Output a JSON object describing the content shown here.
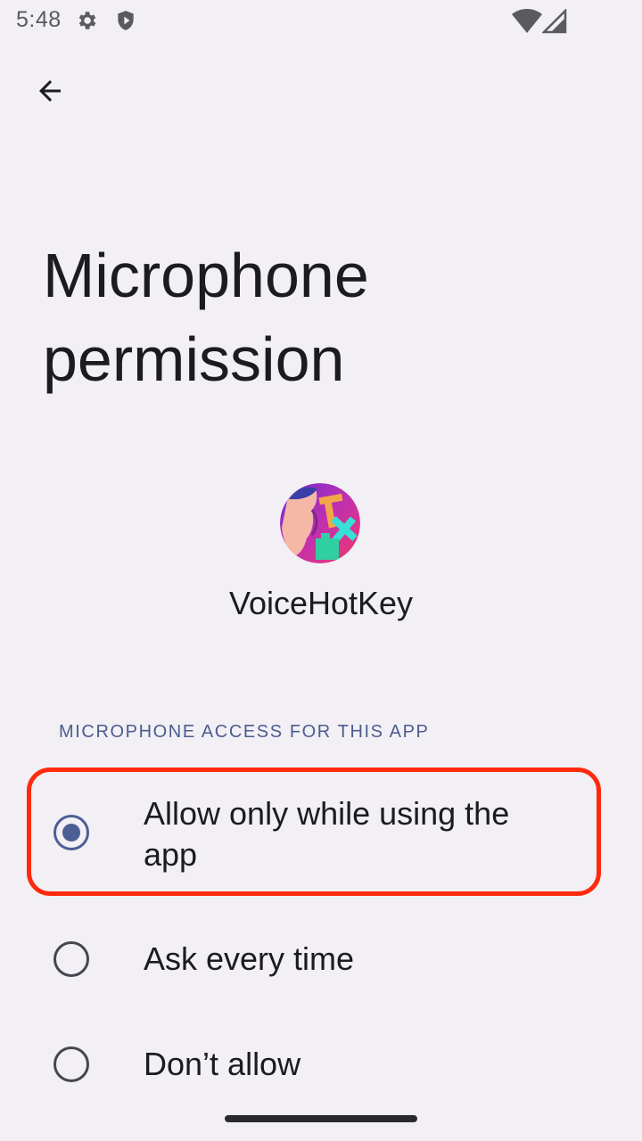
{
  "status_bar": {
    "time": "5:48",
    "icons": [
      "gear-icon",
      "shield-icon",
      "wifi-icon",
      "cell-signal-icon"
    ]
  },
  "header": {
    "back_icon": "arrow-back-icon"
  },
  "page": {
    "title": "Microphone permission"
  },
  "app": {
    "name": "VoiceHotKey",
    "icon": "voicehotkey-app-icon"
  },
  "section": {
    "header": "MICROPHONE ACCESS FOR THIS APP"
  },
  "options": [
    {
      "label": "Allow only while using the app",
      "selected": true
    },
    {
      "label": "Ask every time",
      "selected": false
    },
    {
      "label": "Don’t allow",
      "selected": false
    }
  ],
  "colors": {
    "background": "#f2eff5",
    "accent": "#4c5f94",
    "highlight": "#ff2a0e",
    "section_header": "#4b5d8f"
  }
}
